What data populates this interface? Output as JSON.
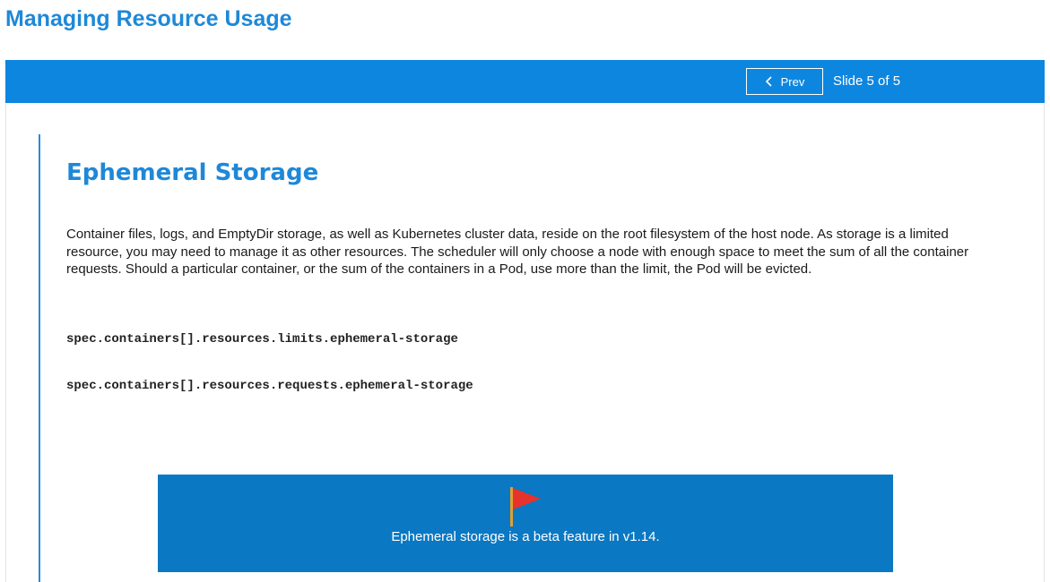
{
  "header": {
    "title": "Managing Resource Usage"
  },
  "nav": {
    "prev_label": "Prev",
    "slide_counter": "Slide 5 of 5"
  },
  "slide": {
    "heading": "Ephemeral Storage",
    "paragraph": "Container files, logs, and EmptyDir storage, as well as Kubernetes cluster data, reside on the root filesystem of the host node. As storage is a limited resource, you may need to manage it as other resources. The scheduler will only choose a node with enough space to meet the sum of all the container requests. Should a particular container, or the sum of the containers in a Pod, use more than the limit, the Pod will be evicted.",
    "code_lines": [
      "spec.containers[].resources.limits.ephemeral-storage",
      "spec.containers[].resources.requests.ephemeral-storage"
    ],
    "callout": {
      "icon": "flag-icon",
      "text": "Ephemeral storage is a beta feature in v1.14."
    }
  },
  "colors": {
    "title_blue": "#1e88d8",
    "nav_bar": "#0d86e0",
    "callout_bg": "#0a78c3",
    "flag_red": "#e8322c",
    "flag_pole": "#e0a030"
  }
}
